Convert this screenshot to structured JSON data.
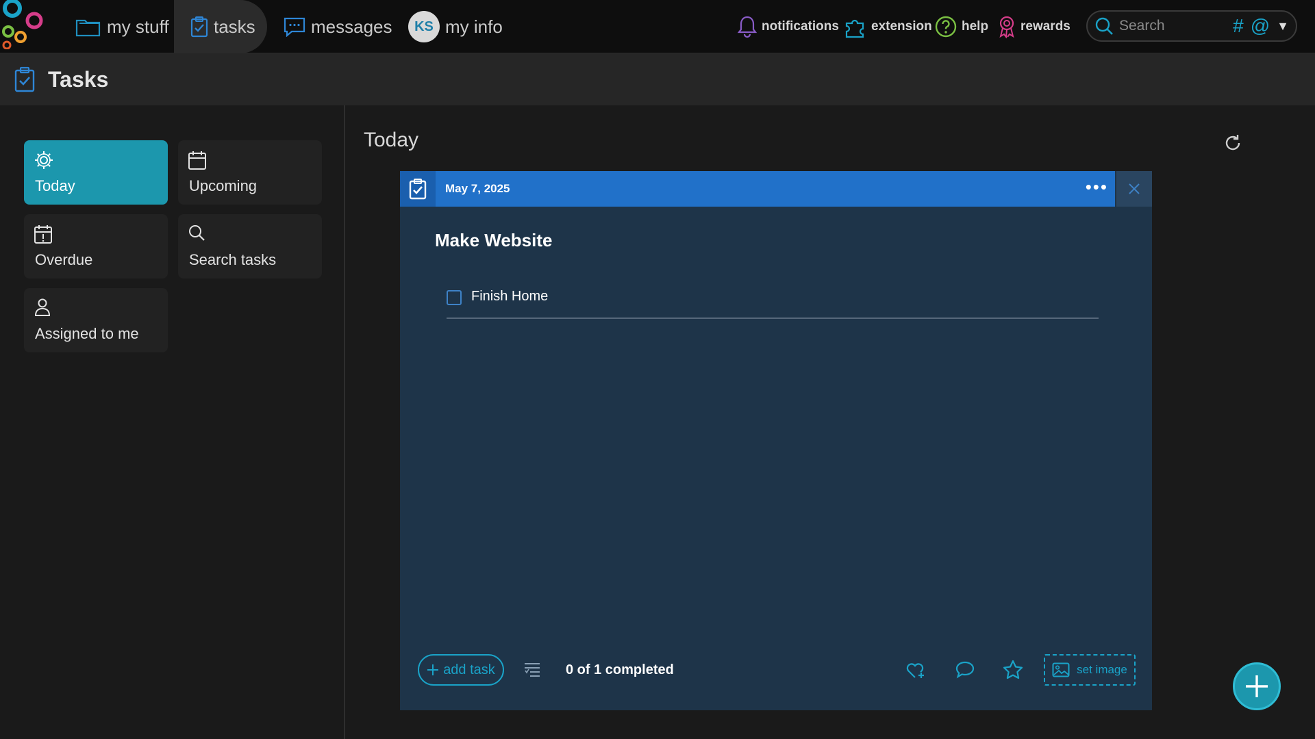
{
  "topnav": {
    "items": [
      {
        "label": "my stuff",
        "icon": "folder-icon"
      },
      {
        "label": "tasks",
        "icon": "clipboard-check-icon"
      },
      {
        "label": "messages",
        "icon": "chat-icon"
      },
      {
        "label": "my info",
        "avatar_initials": "KS"
      }
    ],
    "active_item": "tasks",
    "utilities": [
      {
        "label": "notifications",
        "icon": "bell-icon"
      },
      {
        "label": "extension",
        "icon": "puzzle-icon"
      },
      {
        "label": "help",
        "icon": "help-icon"
      },
      {
        "label": "rewards",
        "icon": "ribbon-icon"
      }
    ],
    "search_placeholder": "Search",
    "search_hash": "#",
    "search_at": "@"
  },
  "page_header": {
    "title": "Tasks"
  },
  "sidebar": {
    "items": [
      {
        "label": "Today",
        "icon": "gear-icon",
        "active": true
      },
      {
        "label": "Upcoming",
        "icon": "calendar-icon"
      },
      {
        "label": "Overdue",
        "icon": "calendar-alert-icon"
      },
      {
        "label": "Search tasks",
        "icon": "search-icon"
      },
      {
        "label": "Assigned to me",
        "icon": "person-icon"
      }
    ]
  },
  "main": {
    "title": "Today",
    "card": {
      "date": "May 7, 2025",
      "title": "Make Website",
      "tasks": [
        {
          "text": "Finish Home",
          "done": false
        }
      ],
      "add_task_label": "add task",
      "completed_summary": "0 of 1 completed",
      "set_image_label": "set image"
    }
  },
  "colors": {
    "accent": "#1aa3c8",
    "active_card": "#1c97ad",
    "card_header": "#2171c9",
    "card_bg": "#1e3449"
  }
}
